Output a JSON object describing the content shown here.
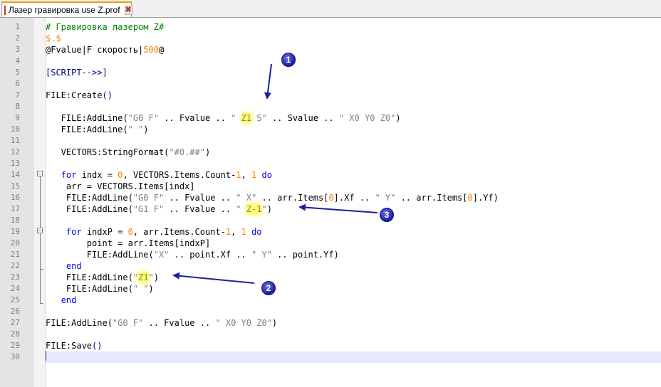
{
  "tab": {
    "title": "Лазер гравировка use Z.prof",
    "close_glyph": "✖",
    "icon": "file-icon"
  },
  "code_lines": [
    {
      "n": "1",
      "t": [
        [
          "c-comment",
          "# Гравировка лазером Z#"
        ]
      ]
    },
    {
      "n": "2",
      "t": [
        [
          "c-num",
          "$.$"
        ]
      ]
    },
    {
      "n": "3",
      "t": [
        [
          "",
          "@Fvalue|F скорость|"
        ],
        [
          "c-num",
          "500"
        ],
        [
          "",
          "@"
        ]
      ]
    },
    {
      "n": "4",
      "t": []
    },
    {
      "n": "5",
      "t": [
        [
          "c-op",
          "[SCRIPT-->>]"
        ]
      ]
    },
    {
      "n": "6",
      "t": []
    },
    {
      "n": "7",
      "t": [
        [
          "",
          "FILE:Create"
        ],
        [
          "c-op",
          "()"
        ]
      ]
    },
    {
      "n": "8",
      "t": []
    },
    {
      "n": "9",
      "t": [
        [
          "",
          "   FILE:AddLine("
        ],
        [
          "c-str",
          "\"G0 F\""
        ],
        [
          "",
          " .. Fvalue .. "
        ],
        [
          "c-str",
          "\" "
        ],
        [
          "c-str hl",
          "Z1"
        ],
        [
          "c-str",
          " S\""
        ],
        [
          "",
          " .. Svalue .. "
        ],
        [
          "c-str",
          "\" X0 Y0 Z0\""
        ],
        [
          "",
          ")"
        ]
      ]
    },
    {
      "n": "10",
      "t": [
        [
          "",
          "   FILE:AddLine("
        ],
        [
          "c-str",
          "\" \""
        ],
        [
          "",
          ")"
        ]
      ]
    },
    {
      "n": "11",
      "t": []
    },
    {
      "n": "12",
      "t": [
        [
          "",
          "   VECTORS:StringFormat("
        ],
        [
          "c-str",
          "\"#0.##\""
        ],
        [
          "",
          ")"
        ]
      ]
    },
    {
      "n": "13",
      "t": []
    },
    {
      "n": "14",
      "t": [
        [
          "",
          "   "
        ],
        [
          "c-kw",
          "for"
        ],
        [
          "",
          " indx = "
        ],
        [
          "c-num",
          "0"
        ],
        [
          "",
          ", VECTORS.Items.Count-"
        ],
        [
          "c-num",
          "1"
        ],
        [
          "",
          ", "
        ],
        [
          "c-num",
          "1"
        ],
        [
          "",
          " "
        ],
        [
          "c-kw",
          "do"
        ]
      ]
    },
    {
      "n": "15",
      "t": [
        [
          "",
          "    arr = VECTORS.Items[indx]"
        ]
      ]
    },
    {
      "n": "16",
      "t": [
        [
          "",
          "    FILE:AddLine("
        ],
        [
          "c-str",
          "\"G0 F\""
        ],
        [
          "",
          " .. Fvalue .. "
        ],
        [
          "c-str",
          "\" X\""
        ],
        [
          "",
          " .. arr.Items["
        ],
        [
          "c-num",
          "0"
        ],
        [
          "",
          "].Xf .. "
        ],
        [
          "c-str",
          "\" Y\""
        ],
        [
          "",
          " .. arr.Items["
        ],
        [
          "c-num",
          "0"
        ],
        [
          "",
          "].Yf)"
        ]
      ]
    },
    {
      "n": "17",
      "t": [
        [
          "",
          "    FILE:AddLine("
        ],
        [
          "c-str",
          "\"G1 F\""
        ],
        [
          "",
          " .. Fvalue .. "
        ],
        [
          "c-str",
          "\" "
        ],
        [
          "c-str hl",
          "Z-1"
        ],
        [
          "c-str",
          "\""
        ],
        [
          "",
          ")"
        ]
      ]
    },
    {
      "n": "18",
      "t": []
    },
    {
      "n": "19",
      "t": [
        [
          "",
          "    "
        ],
        [
          "c-kw",
          "for"
        ],
        [
          "",
          " indxP = "
        ],
        [
          "c-num",
          "0"
        ],
        [
          "",
          ", arr.Items.Count-"
        ],
        [
          "c-num",
          "1"
        ],
        [
          "",
          ", "
        ],
        [
          "c-num",
          "1"
        ],
        [
          "",
          " "
        ],
        [
          "c-kw",
          "do"
        ]
      ]
    },
    {
      "n": "20",
      "t": [
        [
          "",
          "        point = arr.Items[indxP]"
        ]
      ]
    },
    {
      "n": "21",
      "t": [
        [
          "",
          "        FILE:AddLine("
        ],
        [
          "c-str",
          "\"X\""
        ],
        [
          "",
          " .. point.Xf .. "
        ],
        [
          "c-str",
          "\" Y\""
        ],
        [
          "",
          " .. point.Yf)"
        ]
      ]
    },
    {
      "n": "22",
      "t": [
        [
          "",
          "    "
        ],
        [
          "c-kw",
          "end"
        ]
      ]
    },
    {
      "n": "23",
      "t": [
        [
          "",
          "    FILE:AddLine("
        ],
        [
          "c-str",
          "\""
        ],
        [
          "c-str hl",
          "Z1"
        ],
        [
          "c-str",
          "\""
        ],
        [
          "",
          ")"
        ]
      ]
    },
    {
      "n": "24",
      "t": [
        [
          "",
          "    FILE:AddLine("
        ],
        [
          "c-str",
          "\" \""
        ],
        [
          "",
          ")"
        ]
      ]
    },
    {
      "n": "25",
      "t": [
        [
          "",
          "   "
        ],
        [
          "c-kw",
          "end"
        ]
      ]
    },
    {
      "n": "26",
      "t": []
    },
    {
      "n": "27",
      "t": [
        [
          "",
          "FILE:AddLine("
        ],
        [
          "c-str",
          "\"G0 F\""
        ],
        [
          "",
          " .. Fvalue .. "
        ],
        [
          "c-str",
          "\" X0 Y0 Z0\""
        ],
        [
          "",
          ")"
        ]
      ]
    },
    {
      "n": "28",
      "t": []
    },
    {
      "n": "29",
      "t": [
        [
          "",
          "FILE:Save"
        ],
        [
          "c-op",
          "()"
        ]
      ]
    },
    {
      "n": "30",
      "t": []
    }
  ],
  "annotations": [
    {
      "label": "1",
      "icon": "numbered-marker"
    },
    {
      "label": "2",
      "icon": "numbered-marker"
    },
    {
      "label": "3",
      "icon": "numbered-marker"
    }
  ],
  "colors": {
    "comment": "#008000",
    "keyword": "#0000ff",
    "number": "#ff8000",
    "string": "#808080",
    "highlight": "#ffff70",
    "arrow": "#1a1fa0"
  }
}
